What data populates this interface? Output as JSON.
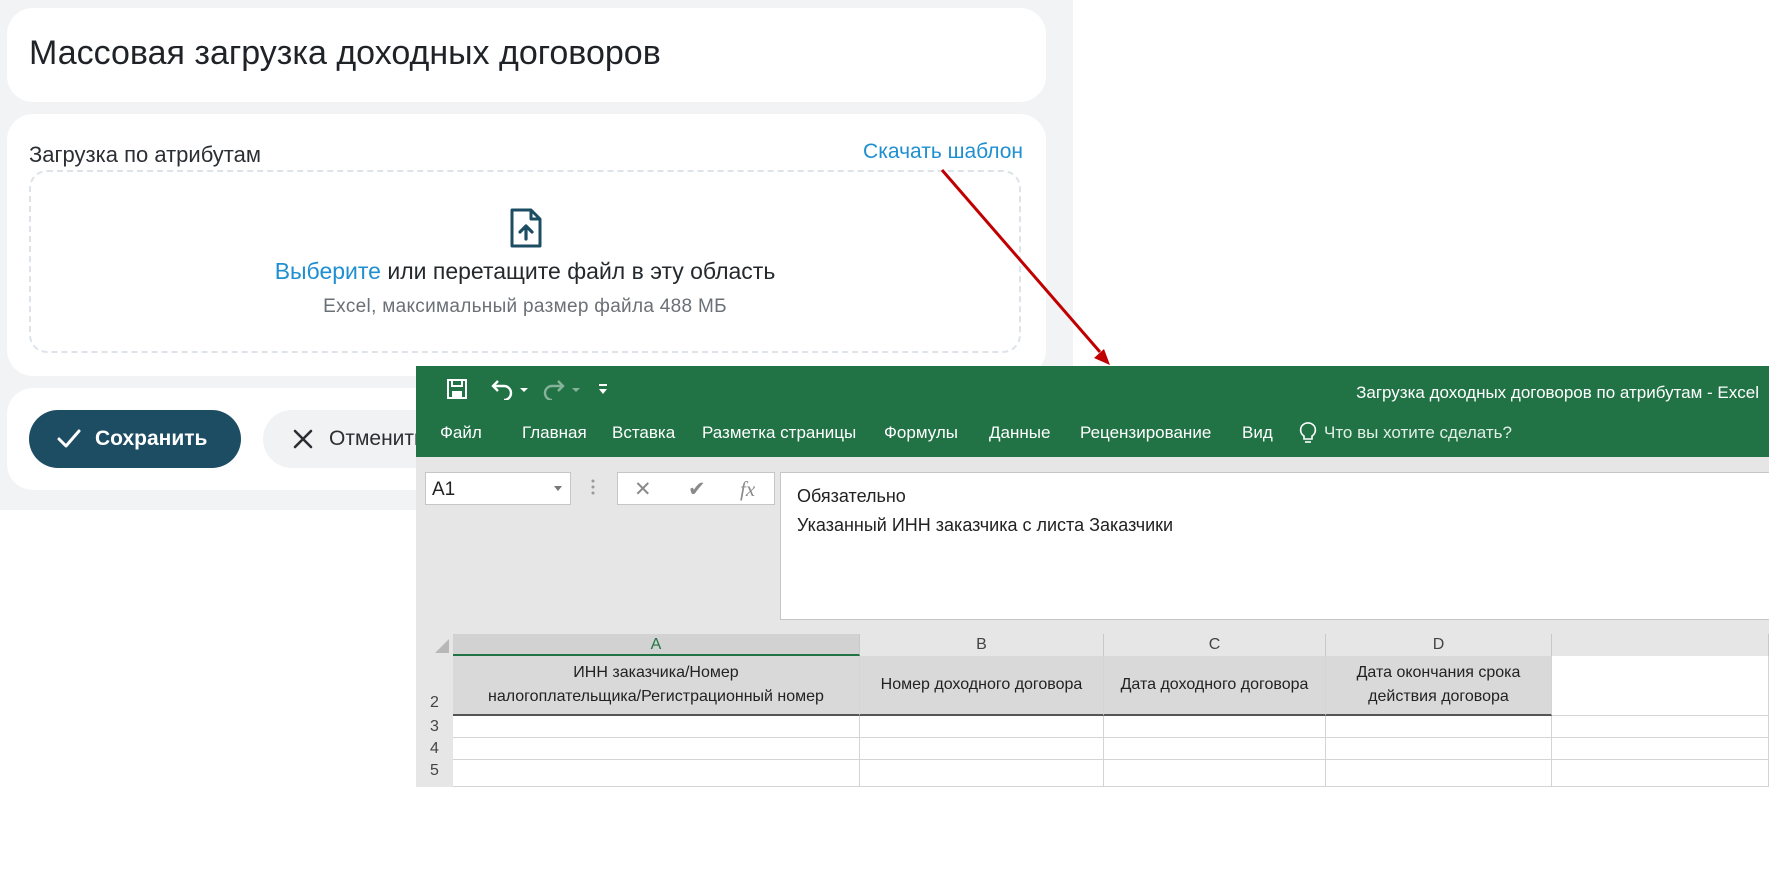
{
  "app": {
    "page_title": "Массовая загрузка доходных договоров",
    "upload": {
      "section_label": "Загрузка по атрибутам",
      "download_template_link": "Скачать шаблон",
      "choose_link": "Выберите",
      "drop_text": " или перетащите файл в эту область",
      "hint": "Excel, максимальный размер файла 488 МБ"
    },
    "actions": {
      "save_label": "Сохранить",
      "cancel_label": "Отменить"
    }
  },
  "excel": {
    "window_title": "Загрузка доходных договоров по атрибутам - Excel",
    "menu": [
      "Файл",
      "Главная",
      "Вставка",
      "Разметка страницы",
      "Формулы",
      "Данные",
      "Рецензирование",
      "Вид"
    ],
    "tell_me": "Что вы хотите сделать?",
    "name_box": "A1",
    "formula_buttons": [
      "✕",
      "✔",
      "fx"
    ],
    "formula_lines": [
      "Обязательно",
      "Указанный ИНН заказчика с листа Заказчики"
    ],
    "columns": [
      "A",
      "B",
      "C",
      "D"
    ],
    "selected_column": "A",
    "header_row_number": "2",
    "headers": [
      [
        "ИНН заказчика/Номер",
        "налогоплательщика/Регистрационный номер"
      ],
      [
        "Номер доходного договора"
      ],
      [
        "Дата доходного договора"
      ],
      [
        "Дата окончания срока",
        "действия договора"
      ]
    ],
    "empty_rows": [
      "3",
      "4",
      "5"
    ]
  },
  "colors": {
    "excel_green": "#217346",
    "primary_button": "#1d4d63",
    "link": "#1f8fd1",
    "arrow": "#c00000"
  },
  "icons": [
    "file-upload-icon",
    "check-icon",
    "close-icon",
    "save-icon",
    "undo-icon",
    "redo-icon",
    "customize-qat-icon",
    "lightbulb-icon",
    "dropdown-icon"
  ]
}
